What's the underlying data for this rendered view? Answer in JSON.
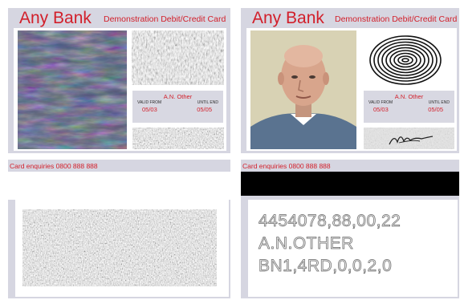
{
  "front_security": {
    "bank_name": "Any Bank",
    "card_type": "Demonstration Debit/Credit Card",
    "holder_name": "A.N. Other",
    "valid_from_label": "VALID FROM",
    "valid_from": "05/03",
    "until_end_label": "UNTIL END",
    "until_end": "05/05",
    "photo_icon": "abstract-texture-icon",
    "fingerprint_icon": "noise-texture-icon",
    "signature_icon": "noise-texture-icon"
  },
  "front_personal": {
    "bank_name": "Any Bank",
    "card_type": "Demonstration Debit/Credit Card",
    "holder_name": "A.N. Other",
    "valid_from_label": "VALID FROM",
    "valid_from": "05/03",
    "until_end_label": "UNTIL END",
    "until_end": "05/05",
    "photo_icon": "portrait-photo-icon",
    "fingerprint_icon": "fingerprint-icon",
    "signature_icon": "signature-icon"
  },
  "back_security": {
    "enquiries": "Card enquiries 0800 888 888",
    "panel_icon": "noise-texture-icon"
  },
  "back_personal": {
    "enquiries": "Card enquiries 0800 888 888",
    "line1": "4454078,88,00,22",
    "line2": "A.N.OTHER",
    "line3": "BN1,4RD,0,0,2,0"
  },
  "colors": {
    "brand_red": "#d21f2a",
    "card_frame": "#d6d6e1",
    "magstripe": "#000000"
  }
}
